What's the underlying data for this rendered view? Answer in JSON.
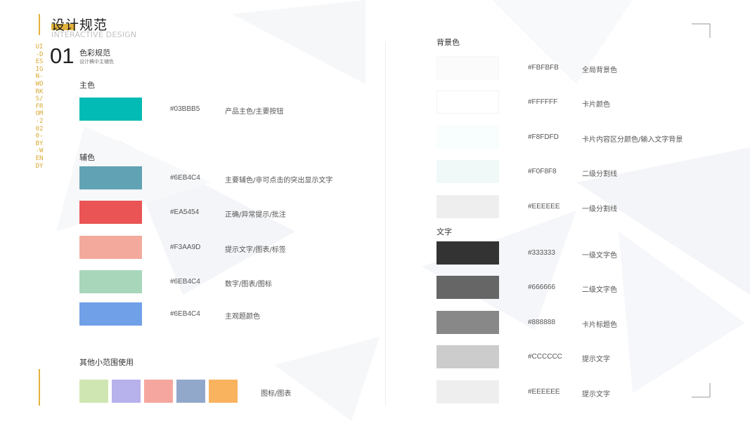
{
  "header": {
    "title": "设计规范",
    "subtitle": "INTERACTIVE DESIGN",
    "vertical_text": "UI-DESIGN-WORKS/FROM-2020-BY-WENDY"
  },
  "section": {
    "number": "01",
    "title": "色彩规范",
    "subtitle": "设计稿中主辅色"
  },
  "left": {
    "main_title": "主色",
    "main": [
      {
        "color": "#03BBB5",
        "hex": "#03BBB5",
        "desc": "产品主色/主要按钮"
      }
    ],
    "aux_title": "辅色",
    "aux": [
      {
        "color": "#61A3B4",
        "hex": "#6EB4C4",
        "desc": "主要辅色/非可点击的突出显示文字"
      },
      {
        "color": "#EA5454",
        "hex": "#EA5454",
        "desc": "正确/异常提示/批注"
      },
      {
        "color": "#F3AA9D",
        "hex": "#F3AA9D",
        "desc": "提示文字/图表/标签"
      },
      {
        "color": "#A8D6BB",
        "hex": "#6EB4C4",
        "desc": "数字/图表/图标"
      },
      {
        "color": "#6FA0E8",
        "hex": "#6EB4C4",
        "desc": "主观题颜色"
      }
    ],
    "other_title": "其他小范围使用",
    "other_colors": [
      "#CFE6B2",
      "#B7B1EC",
      "#F5A79F",
      "#92A8CB",
      "#F9B35F"
    ],
    "other_label": "图标/图表"
  },
  "right": {
    "bg_title": "背景色",
    "bg": [
      {
        "color": "#FBFBFB",
        "hex": "#FBFBFB",
        "desc": "全局背景色"
      },
      {
        "color": "#FFFFFF",
        "hex": "#FFFFFF",
        "desc": "卡片颜色"
      },
      {
        "color": "#F8FDFD",
        "hex": "#F8FDFD",
        "desc": "卡片内容区分颜色/输入文字背景"
      },
      {
        "color": "#F0F8F8",
        "hex": "#F0F8F8",
        "desc": "二级分割线"
      },
      {
        "color": "#EEEEEE",
        "hex": "#EEEEEE",
        "desc": "一级分割线"
      }
    ],
    "text_title": "文字",
    "text": [
      {
        "color": "#333333",
        "hex": "#333333",
        "desc": "一级文字色"
      },
      {
        "color": "#666666",
        "hex": "#666666",
        "desc": "二级文字色"
      },
      {
        "color": "#888888",
        "hex": "#888888",
        "desc": "卡片标题色"
      },
      {
        "color": "#CCCCCC",
        "hex": "#CCCCCC",
        "desc": "提示文字"
      },
      {
        "color": "#EEEEEE",
        "hex": "#EEEEEE",
        "desc": "提示文字"
      }
    ]
  },
  "colors": {
    "accent": "#E3B23C"
  }
}
